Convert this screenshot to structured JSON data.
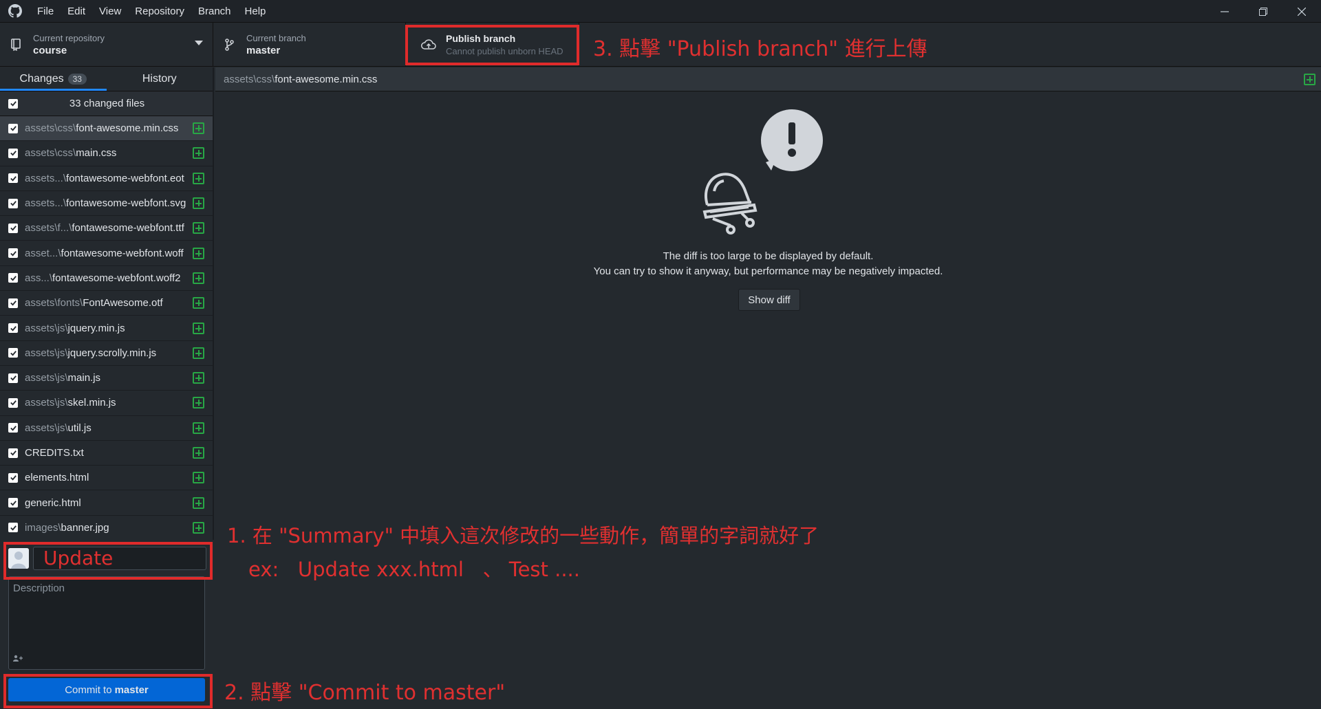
{
  "menu": [
    "File",
    "Edit",
    "View",
    "Repository",
    "Branch",
    "Help"
  ],
  "toolbar": {
    "repo_label": "Current repository",
    "repo_value": "course",
    "branch_label": "Current branch",
    "branch_value": "master",
    "publish_label": "Publish branch",
    "publish_sub": "Cannot publish unborn HEAD"
  },
  "tabs": {
    "changes_label": "Changes",
    "changes_count": "33",
    "history_label": "History"
  },
  "changes": {
    "header": "33 changed files",
    "files": [
      {
        "dir": "assets\\css\\",
        "name": "font-awesome.min.css"
      },
      {
        "dir": "assets\\css\\",
        "name": "main.css"
      },
      {
        "dir": "assets...\\",
        "name": "fontawesome-webfont.eot"
      },
      {
        "dir": "assets...\\",
        "name": "fontawesome-webfont.svg"
      },
      {
        "dir": "assets\\f...\\",
        "name": "fontawesome-webfont.ttf"
      },
      {
        "dir": "asset...\\",
        "name": "fontawesome-webfont.woff"
      },
      {
        "dir": "ass...\\",
        "name": "fontawesome-webfont.woff2"
      },
      {
        "dir": "assets\\fonts\\",
        "name": "FontAwesome.otf"
      },
      {
        "dir": "assets\\js\\",
        "name": "jquery.min.js"
      },
      {
        "dir": "assets\\js\\",
        "name": "jquery.scrolly.min.js"
      },
      {
        "dir": "assets\\js\\",
        "name": "main.js"
      },
      {
        "dir": "assets\\js\\",
        "name": "skel.min.js"
      },
      {
        "dir": "assets\\js\\",
        "name": "util.js"
      },
      {
        "dir": "",
        "name": "CREDITS.txt"
      },
      {
        "dir": "",
        "name": "elements.html"
      },
      {
        "dir": "",
        "name": "generic.html"
      },
      {
        "dir": "images\\",
        "name": "banner.jpg"
      }
    ]
  },
  "commit": {
    "summary_value": "Update",
    "description_placeholder": "Description",
    "coauthor_icon": "+",
    "button_prefix": "Commit to",
    "button_branch": "master"
  },
  "main": {
    "path_dir": "assets\\css\\",
    "path_file": "font-awesome.min.css",
    "message_line1": "The diff is too large to be displayed by default.",
    "message_line2": "You can try to show it anyway, but performance may be negatively impacted.",
    "show_diff_label": "Show diff"
  },
  "annotations": {
    "step3": "3. 點擊 \"Publish branch\" 進行上傳",
    "step1_line1": "1. 在 \"Summary\" 中填入這次修改的一些動作，簡單的字詞就好了",
    "step1_line2": "ex:   Update xxx.html   、 Test ....",
    "step2": "2. 點擊 \"Commit to master\""
  },
  "colors": {
    "accent": "#0366d6",
    "annotation": "#e03030",
    "added": "#28a745"
  }
}
